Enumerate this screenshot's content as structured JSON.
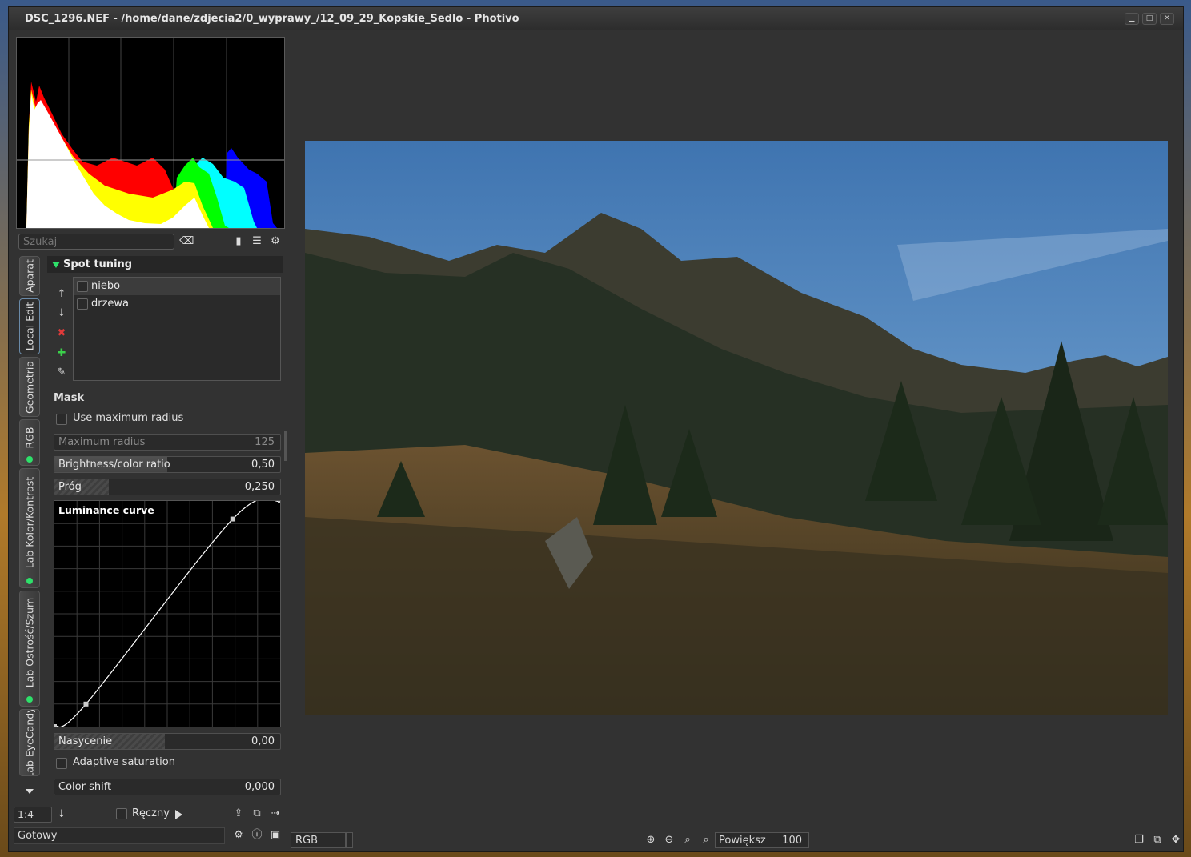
{
  "window": {
    "title": "DSC_1296.NEF - /home/dane/zdjecia2/0_wyprawy_/12_09_29_Kopskie_Sedlo - Photivo",
    "controls": [
      "minimize",
      "maximize",
      "close"
    ]
  },
  "search": {
    "placeholder": "Szukaj"
  },
  "vertical_tabs": [
    {
      "label": "Aparat",
      "active": false
    },
    {
      "label": "Local Edit",
      "active": true
    },
    {
      "label": "Geometria",
      "active": false
    },
    {
      "label": "RGB",
      "active": false
    },
    {
      "label": "Lab Kolor/Kontrast",
      "active": false
    },
    {
      "label": "Lab Ostrość/Szum",
      "active": false
    },
    {
      "label": "Lab EyeCandy",
      "active": false
    }
  ],
  "spot_tuning": {
    "header": "Spot tuning",
    "spots": [
      "niebo",
      "drzewa"
    ],
    "mask_label": "Mask",
    "use_max_radius": "Use maximum radius",
    "max_radius": {
      "label": "Maximum radius",
      "value": "125"
    },
    "brightness_ratio": {
      "label": "Brightness/color ratio",
      "value": "0,50",
      "fraction": 0.5
    },
    "threshold": {
      "label": "Próg",
      "value": "0,250",
      "fraction": 0.24
    },
    "curve_title": "Luminance curve",
    "curve_points": [
      [
        0,
        0
      ],
      [
        0.14,
        0.1
      ],
      [
        0.79,
        0.92
      ],
      [
        1,
        1
      ]
    ],
    "saturation": {
      "label": "Nasycenie",
      "value": "0,00",
      "fraction": 0.49
    },
    "adaptive_saturation": "Adaptive saturation",
    "color_shift": {
      "label": "Color shift",
      "value": "0,000",
      "fraction": 0.0
    }
  },
  "bottom_left": {
    "zoom_ratio": "1:4",
    "manual_label": "Ręczny",
    "status": "Gotowy"
  },
  "bottom_right": {
    "colorspace": "RGB",
    "zoom_label": "Powiększ",
    "zoom_value": "100"
  },
  "colors": {
    "accent_green": "#2ee06a",
    "panel_bg": "#323232"
  }
}
